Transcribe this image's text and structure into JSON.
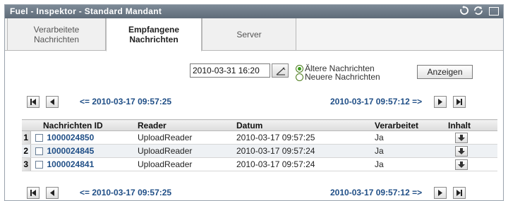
{
  "window": {
    "title": "Fuel - Inspektor - Standard Mandant"
  },
  "title_controls": [
    "reset-icon",
    "refresh-icon",
    "maximize-icon"
  ],
  "tabs": [
    {
      "label_line1": "Verarbeitete",
      "label_line2": "Nachrichten",
      "active": false
    },
    {
      "label_line1": "Empfangene",
      "label_line2": "Nachrichten",
      "active": true
    },
    {
      "label_line1": "Server",
      "label_line2": "",
      "active": false
    }
  ],
  "filter": {
    "date_value": "2010-03-31 16:20",
    "radio_older": "Ältere Nachrichten",
    "radio_newer": "Neuere Nachrichten",
    "selected": "older",
    "show_button": "Anzeigen"
  },
  "pagination": {
    "prev_label": "<= 2010-03-17 09:57:25",
    "next_label": "2010-03-17 09:57:12 =>"
  },
  "table": {
    "headers": {
      "id": "Nachrichten ID",
      "reader": "Reader",
      "date": "Datum",
      "processed": "Verarbeitet",
      "content": "Inhalt"
    },
    "rows": [
      {
        "num": "1",
        "id": "1000024850",
        "reader": "UploadReader",
        "date": "2010-03-17 09:57:25",
        "processed": "Ja"
      },
      {
        "num": "2",
        "id": "1000024845",
        "reader": "UploadReader",
        "date": "2010-03-17 09:57:24",
        "processed": "Ja"
      },
      {
        "num": "3",
        "id": "1000024841",
        "reader": "UploadReader",
        "date": "2010-03-17 09:57:24",
        "processed": "Ja"
      }
    ]
  },
  "colors": {
    "titlebar": "#6f7c89",
    "link": "#1f4e86",
    "radio": "#3b9b1b"
  }
}
